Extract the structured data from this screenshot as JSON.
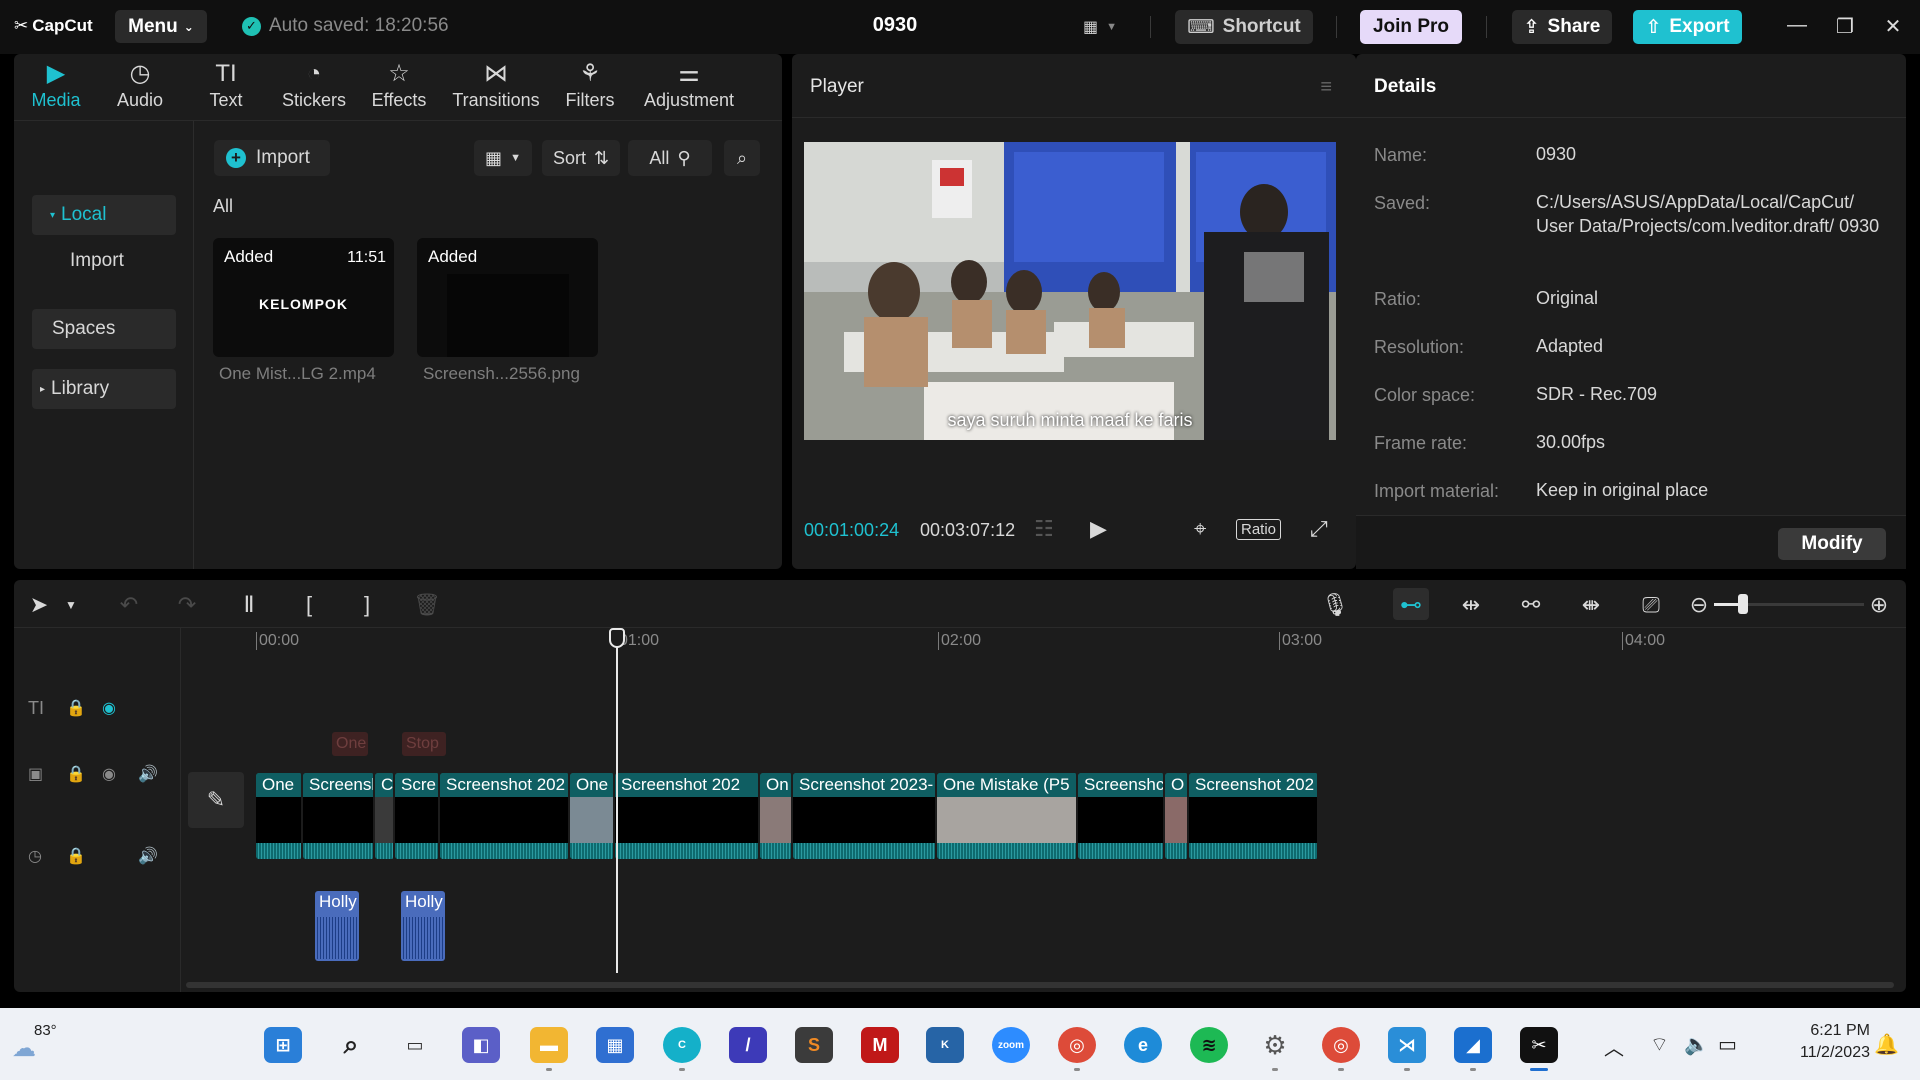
{
  "titlebar": {
    "logo": "CapCut",
    "menu_label": "Menu",
    "autosave": "Auto saved: 18:20:56",
    "project_title": "0930",
    "shortcut_label": "Shortcut",
    "joinpro_label": "Join Pro",
    "share_label": "Share",
    "export_label": "Export"
  },
  "media": {
    "tabs": [
      {
        "label": "Media",
        "icon": "media-icon"
      },
      {
        "label": "Audio",
        "icon": "audio-icon"
      },
      {
        "label": "Text",
        "icon": "text-icon"
      },
      {
        "label": "Stickers",
        "icon": "stickers-icon"
      },
      {
        "label": "Effects",
        "icon": "effects-icon"
      },
      {
        "label": "Transitions",
        "icon": "transitions-icon"
      },
      {
        "label": "Filters",
        "icon": "filters-icon"
      },
      {
        "label": "Adjustment",
        "icon": "adjustment-icon"
      }
    ],
    "sidebar": [
      {
        "label": "Local"
      },
      {
        "label": "Import"
      },
      {
        "label": "Spaces"
      },
      {
        "label": "Library"
      }
    ],
    "import_label": "Import",
    "sort_label": "Sort",
    "filter_all_label": "All",
    "section_label": "All",
    "items": [
      {
        "badge": "Added",
        "duration": "11:51",
        "thumb_text": "KELOMPOK",
        "name": "One Mist...LG 2.mp4"
      },
      {
        "badge": "Added",
        "duration": "",
        "thumb_text": "",
        "name": "Screensh...2556.png"
      }
    ]
  },
  "player": {
    "title": "Player",
    "subtitle": "saya suruh minta maaf ke faris",
    "current_time": "00:01:00:24",
    "total_time": "00:03:07:12",
    "ratio_label": "Ratio"
  },
  "details": {
    "title": "Details",
    "rows": [
      {
        "label": "Name:",
        "value": "0930"
      },
      {
        "label": "Saved:",
        "value": "C:/Users/ASUS/AppData/Local/CapCut/ User Data/Projects/com.lveditor.draft/ 0930"
      },
      {
        "label": "Ratio:",
        "value": "Original"
      },
      {
        "label": "Resolution:",
        "value": "Adapted"
      },
      {
        "label": "Color space:",
        "value": "SDR - Rec.709"
      },
      {
        "label": "Frame rate:",
        "value": "30.00fps"
      },
      {
        "label": "Import material:",
        "value": "Keep in original place"
      }
    ],
    "modify_label": "Modify"
  },
  "timeline": {
    "ruler": [
      "00:00",
      "01:00",
      "02:00",
      "03:00",
      "04:00"
    ],
    "text_chips": [
      "One",
      "Stop"
    ],
    "clips": [
      "One",
      "Screensl",
      "C",
      "Scre",
      "Screenshot 202",
      "One",
      "Screenshot 202",
      "On",
      "Screenshot 2023-",
      "One Mistake (P5",
      "Screenshc",
      "O",
      "Screenshot 202"
    ],
    "audio_clips": [
      "Holly",
      "Holly"
    ],
    "zoom_level": 0.2
  },
  "taskbar": {
    "temperature": "83°",
    "time": "6:21 PM",
    "date": "11/2/2023",
    "apps": [
      "start-icon",
      "search-icon",
      "task-view-icon",
      "chat-icon",
      "file-explorer-icon",
      "store-icon",
      "canva-icon",
      "app-icon",
      "sublime-icon",
      "mcafee-icon",
      "kali-icon",
      "zoom-icon",
      "chrome-icon",
      "edge-icon",
      "spotify-icon",
      "settings-icon",
      "chrome-profile-icon",
      "vscode-icon",
      "app-icon",
      "capcut-icon"
    ]
  },
  "colors": {
    "accent": "#1fc1d0",
    "clip": "#0e6a6e",
    "audio_clip": "#4a6cbc",
    "join_pro": "#e6daf9"
  }
}
